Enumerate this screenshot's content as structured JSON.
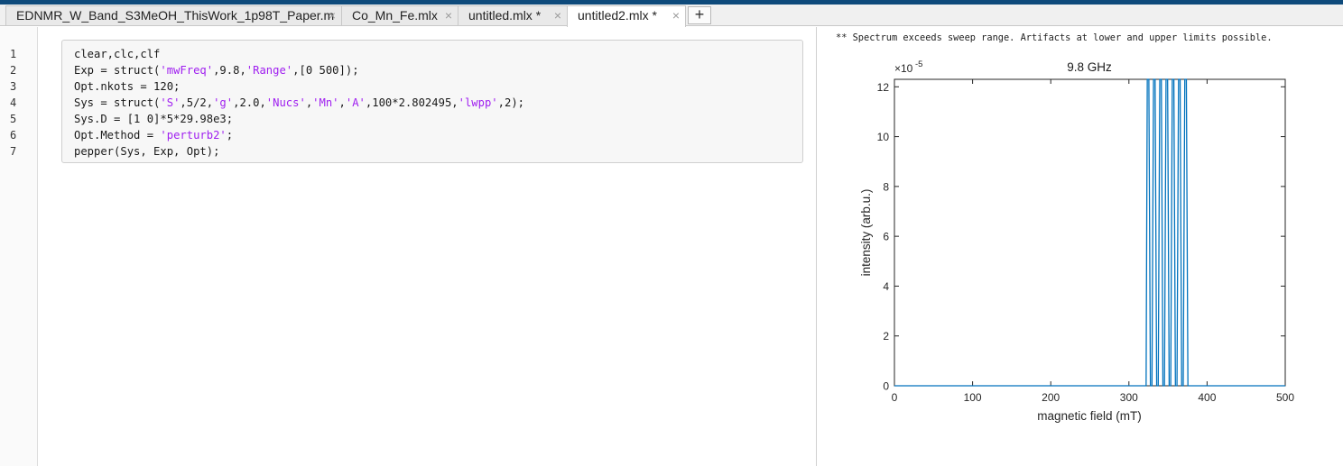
{
  "tabs": [
    {
      "label": "EDNMR_W_Band_S3MeOH_ThisWork_1p98T_Paper.m",
      "active": false
    },
    {
      "label": "Co_Mn_Fe.mlx",
      "active": false
    },
    {
      "label": "untitled.mlx *",
      "active": false
    },
    {
      "label": "untitled2.mlx *",
      "active": true
    }
  ],
  "icons": {
    "close": "close-icon",
    "add": "plus-icon"
  },
  "tab_close_glyph": "×",
  "add_tab_label": "+",
  "editor": {
    "line_numbers": [
      "1",
      "2",
      "3",
      "4",
      "5",
      "6",
      "7"
    ]
  },
  "output": {
    "warning": "** Spectrum exceeds sweep range. Artifacts at lower and upper limits possible."
  },
  "chart_data": {
    "type": "line",
    "title": "9.8 GHz",
    "xlabel": "magnetic field (mT)",
    "ylabel": "intensity (arb.u.)",
    "y_exponent_label": "×10",
    "y_exponent": "-5",
    "xlim": [
      0,
      500
    ],
    "ylim": [
      0,
      12.3
    ],
    "xticks": [
      0,
      100,
      200,
      300,
      400,
      500
    ],
    "yticks": [
      0,
      2,
      4,
      6,
      8,
      10,
      12
    ],
    "grid": false,
    "line_color": "#0072bd",
    "series": [
      {
        "x": [
          0,
          322,
          323.5,
          325.5,
          327.5,
          329.5,
          331.5,
          333.5,
          335.5,
          337.5,
          339.5,
          341.5,
          343.5,
          345.5,
          347.5,
          349.5,
          351.5,
          353.5,
          355.5,
          357.5,
          359.5,
          361.5,
          363.5,
          365.5,
          367.5,
          369.5,
          371.5,
          373.5,
          375.5,
          377.5,
          379,
          500
        ],
        "y": [
          0,
          0,
          12.3,
          12.3,
          0,
          0,
          12.3,
          12.3,
          0,
          0,
          12.3,
          12.3,
          0,
          0,
          12.3,
          12.3,
          0,
          0,
          12.3,
          12.3,
          0,
          0,
          12.3,
          12.3,
          0,
          0,
          12.3,
          12.3,
          0,
          0,
          0,
          0
        ]
      }
    ]
  },
  "colors": {
    "accent": "#0e4a7b",
    "string": "#a020f0",
    "plot_line": "#0072bd"
  }
}
